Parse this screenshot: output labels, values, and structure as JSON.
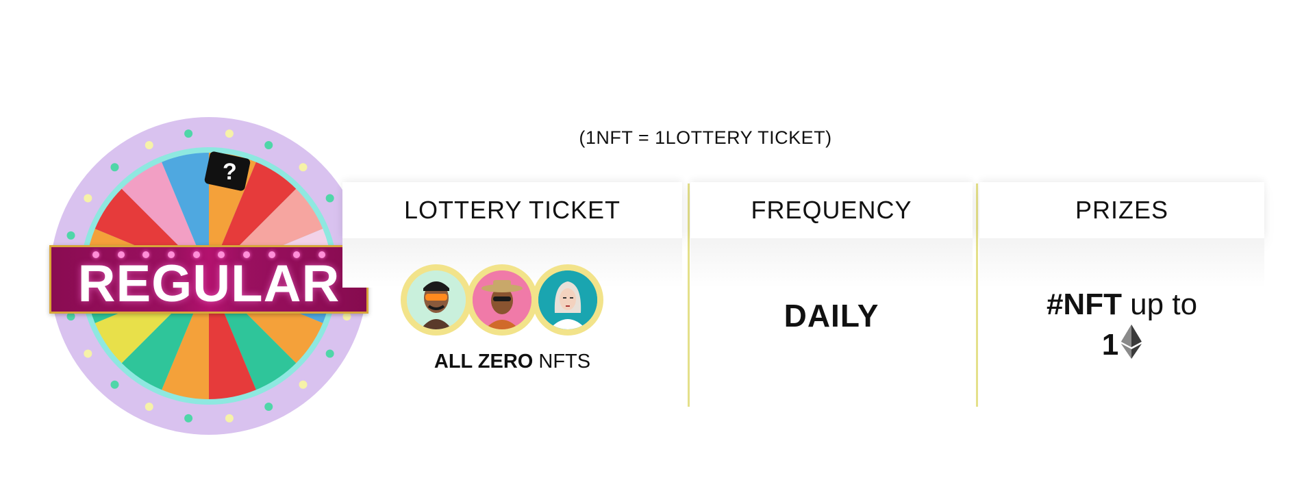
{
  "note": "(1NFT = 1LOTTERY TICKET)",
  "wheel": {
    "banner": "REGULAR",
    "segment_colors": [
      "#f4a13a",
      "#e63b3b",
      "#f6a5a0",
      "#f2d2e8",
      "#4fa8e0",
      "#f4a13a",
      "#2fc59a",
      "#e63b3b",
      "#f4a13a",
      "#2fc59a",
      "#e8e04a",
      "#2fc59a",
      "#f4a13a",
      "#e63b3b",
      "#f29fc4",
      "#4fa8e0"
    ],
    "rim_color": "#d9c2ef",
    "inner_ring_color": "#8ee8e0"
  },
  "columns": [
    {
      "header": "LOTTERY TICKET",
      "avatar_icons": [
        "avatar-sunglasses-icon",
        "avatar-hat-icon",
        "avatar-hooded-icon"
      ],
      "tag_strong": "ALL ZERO",
      "tag_normal": " NFTS"
    },
    {
      "header": "FREQUENCY",
      "value": "DAILY"
    },
    {
      "header": "PRIZES",
      "line1_strong": "#NFT",
      "line1_normal": " up to",
      "line2_strong": "1",
      "currency_icon": "ethereum-icon"
    }
  ],
  "colors": {
    "divider": "#e4e08a",
    "avatar_ring": "#f2e38a",
    "banner": "#9b1060"
  }
}
